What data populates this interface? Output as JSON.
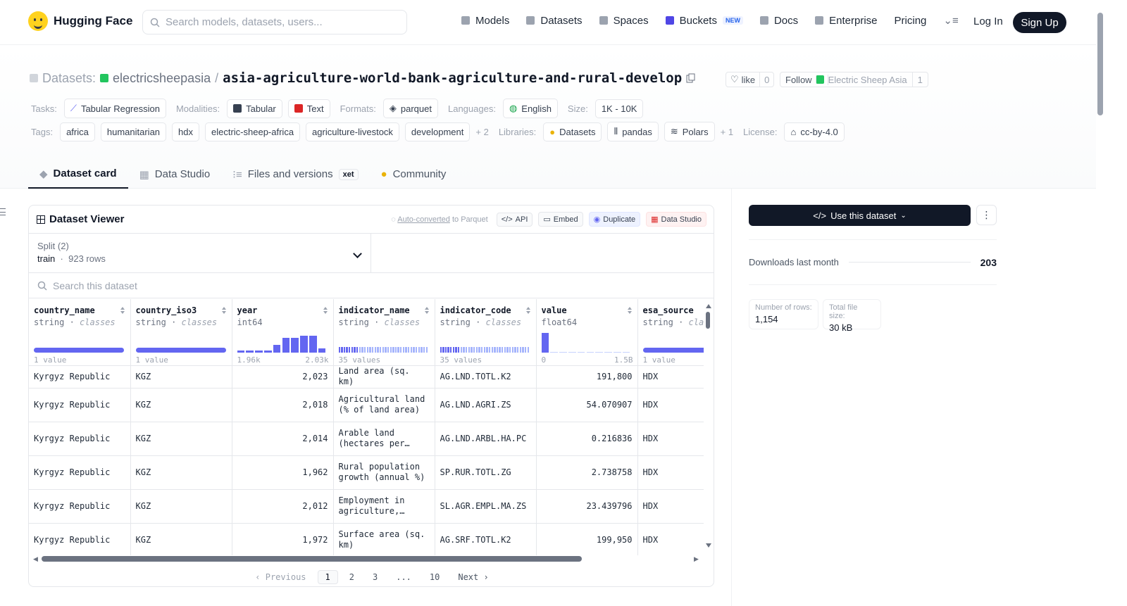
{
  "nav": {
    "brand": "Hugging Face",
    "search_placeholder": "Search models, datasets, users...",
    "links": [
      {
        "label": "Models",
        "icon": "cube-icon"
      },
      {
        "label": "Datasets",
        "icon": "database-icon"
      },
      {
        "label": "Spaces",
        "icon": "grid-icon"
      },
      {
        "label": "Buckets",
        "icon": "bucket-icon",
        "badge": "NEW"
      },
      {
        "label": "Docs",
        "icon": "book-icon"
      },
      {
        "label": "Enterprise",
        "icon": "enterprise-icon"
      },
      {
        "label": "Pricing"
      }
    ],
    "login": "Log In",
    "signup": "Sign Up"
  },
  "header": {
    "prefix": "Datasets:",
    "org": "electricsheepasia",
    "sep": "/",
    "name": "asia-agriculture-world-bank-agriculture-and-rural-develop",
    "like_label": "like",
    "like_count": "0",
    "follow_label": "Follow",
    "follow_org": "Electric Sheep Asia",
    "follow_count": "1"
  },
  "meta": {
    "tasks_label": "Tasks:",
    "task": "Tabular Regression",
    "modalities_label": "Modalities:",
    "modalities": [
      "Tabular",
      "Text"
    ],
    "formats_label": "Formats:",
    "format": "parquet",
    "languages_label": "Languages:",
    "language": "English",
    "size_label": "Size:",
    "size": "1K - 10K",
    "tags_label": "Tags:",
    "tags": [
      "africa",
      "humanitarian",
      "hdx",
      "electric-sheep-africa",
      "agriculture-livestock",
      "development"
    ],
    "tags_more": "+ 2",
    "libraries_label": "Libraries:",
    "libraries": [
      "Datasets",
      "pandas",
      "Polars"
    ],
    "libraries_more": "+ 1",
    "license_label": "License:",
    "license": "cc-by-4.0"
  },
  "tabs": [
    {
      "label": "Dataset card",
      "active": true
    },
    {
      "label": "Data Studio"
    },
    {
      "label": "Files and versions",
      "badge": "xet"
    },
    {
      "label": "Community"
    }
  ],
  "viewer": {
    "title": "Dataset Viewer",
    "auto_converted": "Auto-converted",
    "to_parquet": " to Parquet",
    "actions": [
      "API",
      "Embed",
      "Duplicate",
      "Data Studio"
    ],
    "split_label": "Split (2)",
    "split_name": "train",
    "split_rows": "923 rows",
    "search_placeholder": "Search this dataset",
    "columns": [
      {
        "name": "country_name",
        "type": "string",
        "kind": "classes",
        "hist_left": "1 value",
        "hist_right": ""
      },
      {
        "name": "country_iso3",
        "type": "string",
        "kind": "classes",
        "hist_left": "1 value",
        "hist_right": ""
      },
      {
        "name": "year",
        "type": "int64",
        "kind": "",
        "hist_left": "1.96k",
        "hist_right": "2.03k"
      },
      {
        "name": "indicator_name",
        "type": "string",
        "kind": "classes",
        "hist_left": "35 values",
        "hist_right": ""
      },
      {
        "name": "indicator_code",
        "type": "string",
        "kind": "classes",
        "hist_left": "35 values",
        "hist_right": ""
      },
      {
        "name": "value",
        "type": "float64",
        "kind": "",
        "hist_left": "0",
        "hist_right": "1.5B"
      },
      {
        "name": "esa_source",
        "type": "string",
        "kind": "classes",
        "hist_left": "1 value",
        "hist_right": ""
      }
    ],
    "year_hist": [
      0.1,
      0.1,
      0.1,
      0.1,
      0.4,
      0.75,
      0.75,
      0.85,
      0.85,
      0.2
    ],
    "value_hist": [
      1.0,
      0.04,
      0.04,
      0.04,
      0.04,
      0.04,
      0.04,
      0.04,
      0.04,
      0.04
    ],
    "rows": [
      [
        "Kyrgyz Republic",
        "KGZ",
        "2,023",
        "Land area (sq. km)",
        "AG.LND.TOTL.K2",
        "191,800",
        "HDX"
      ],
      [
        "Kyrgyz Republic",
        "KGZ",
        "2,018",
        "Agricultural land (% of land area)",
        "AG.LND.AGRI.ZS",
        "54.070907",
        "HDX"
      ],
      [
        "Kyrgyz Republic",
        "KGZ",
        "2,014",
        "Arable land (hectares per…",
        "AG.LND.ARBL.HA.PC",
        "0.216836",
        "HDX"
      ],
      [
        "Kyrgyz Republic",
        "KGZ",
        "1,962",
        "Rural population growth (annual %)",
        "SP.RUR.TOTL.ZG",
        "2.738758",
        "HDX"
      ],
      [
        "Kyrgyz Republic",
        "KGZ",
        "2,012",
        "Employment in agriculture, male…",
        "SL.AGR.EMPL.MA.ZS",
        "23.439796",
        "HDX"
      ],
      [
        "Kyrgyz Republic",
        "KGZ",
        "1,972",
        "Surface area (sq. km)",
        "AG.SRF.TOTL.K2",
        "199,950",
        "HDX"
      ]
    ],
    "pager": {
      "prev": "Previous",
      "pages": [
        "1",
        "2",
        "3",
        "...",
        "10"
      ],
      "next": "Next"
    }
  },
  "side": {
    "use_label": "Use this dataset",
    "downloads_label": "Downloads last month",
    "downloads": "203",
    "rows_label": "Number of rows:",
    "rows": "1,154",
    "size_label": "Total file size:",
    "size": "30 kB"
  },
  "colors": {
    "accent": "#6366f1",
    "dark": "#111827"
  }
}
